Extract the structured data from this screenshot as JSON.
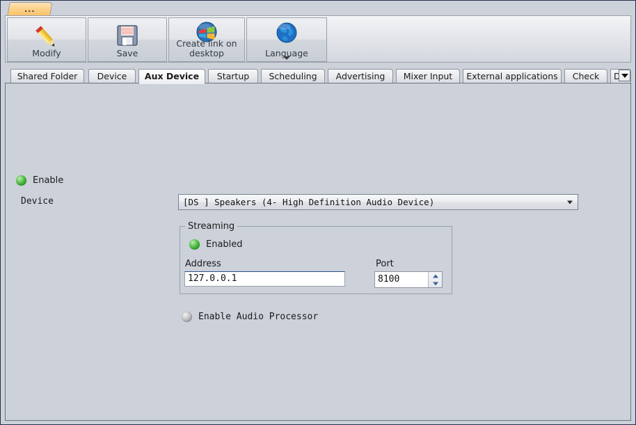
{
  "window": {
    "file_tab_label": "..."
  },
  "ribbon": {
    "buttons": [
      {
        "label": "Modify",
        "icon": "pencil-icon"
      },
      {
        "label": "Save",
        "icon": "floppy-disk-icon"
      },
      {
        "label": "Create link on desktop",
        "icon": "windows-logo-icon"
      },
      {
        "label": "Language",
        "icon": "globe-icon",
        "has_dropdown": true
      }
    ]
  },
  "tabs": {
    "items": [
      {
        "label": "Shared Folder",
        "selected": false
      },
      {
        "label": "Device",
        "selected": false
      },
      {
        "label": "Aux Device",
        "selected": true
      },
      {
        "label": "Startup",
        "selected": false
      },
      {
        "label": "Scheduling",
        "selected": false
      },
      {
        "label": "Advertising",
        "selected": false
      },
      {
        "label": "Mixer Input",
        "selected": false
      },
      {
        "label": "External applications",
        "selected": false
      },
      {
        "label": "Check",
        "selected": false
      },
      {
        "label": "De",
        "selected": false
      }
    ],
    "overflow_icon": "chevron-down-icon"
  },
  "content": {
    "enable": {
      "label": "Enable",
      "state": "on",
      "led_color": "#4fbc43"
    },
    "device": {
      "label": "Device",
      "value": "[DS ] Speakers (4- High Definition Audio Device)"
    },
    "streaming": {
      "legend": "Streaming",
      "enabled": {
        "label": "Enabled",
        "state": "on",
        "led_color": "#4fbc43"
      },
      "address": {
        "label": "Address",
        "value": "127.0.0.1"
      },
      "port": {
        "label": "Port",
        "value": "8100"
      }
    },
    "audio_processor": {
      "label": "Enable Audio Processor",
      "state": "off",
      "led_color": "#a8a8a8"
    }
  }
}
